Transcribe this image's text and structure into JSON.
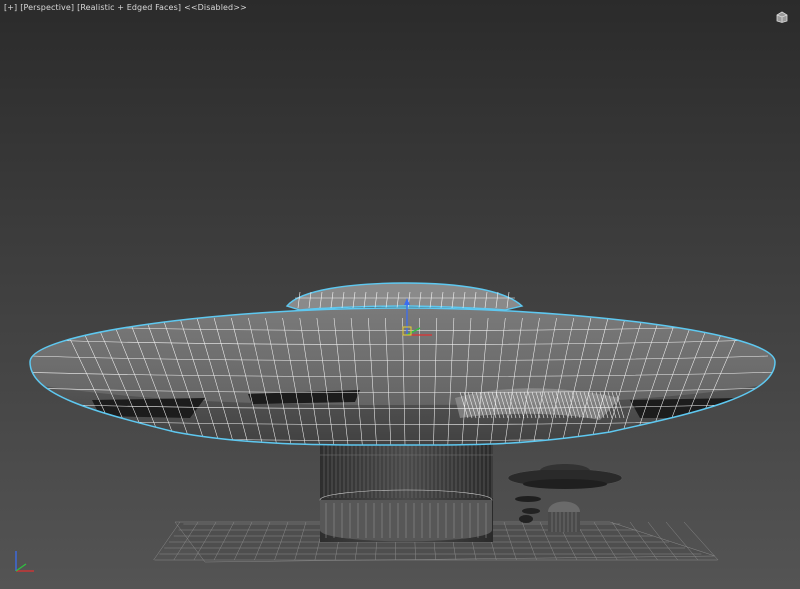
{
  "viewport": {
    "menu_plus": "[+]",
    "view_mode": "[Perspective]",
    "shading_mode": "[Realistic + Edged Faces]",
    "state": "<<Disabled>>"
  },
  "icons": {
    "viewcube": "home-cube-icon",
    "axis_tripod": "axis-tripod-icon",
    "gizmo": "transform-gizmo-icon"
  },
  "colors": {
    "background_top": "#2b2b2b",
    "background_bottom": "#545454",
    "selection_outline": "#5ec8f0",
    "wire": "#f2f2f2",
    "mesh_fill": "#6a6a6a"
  }
}
